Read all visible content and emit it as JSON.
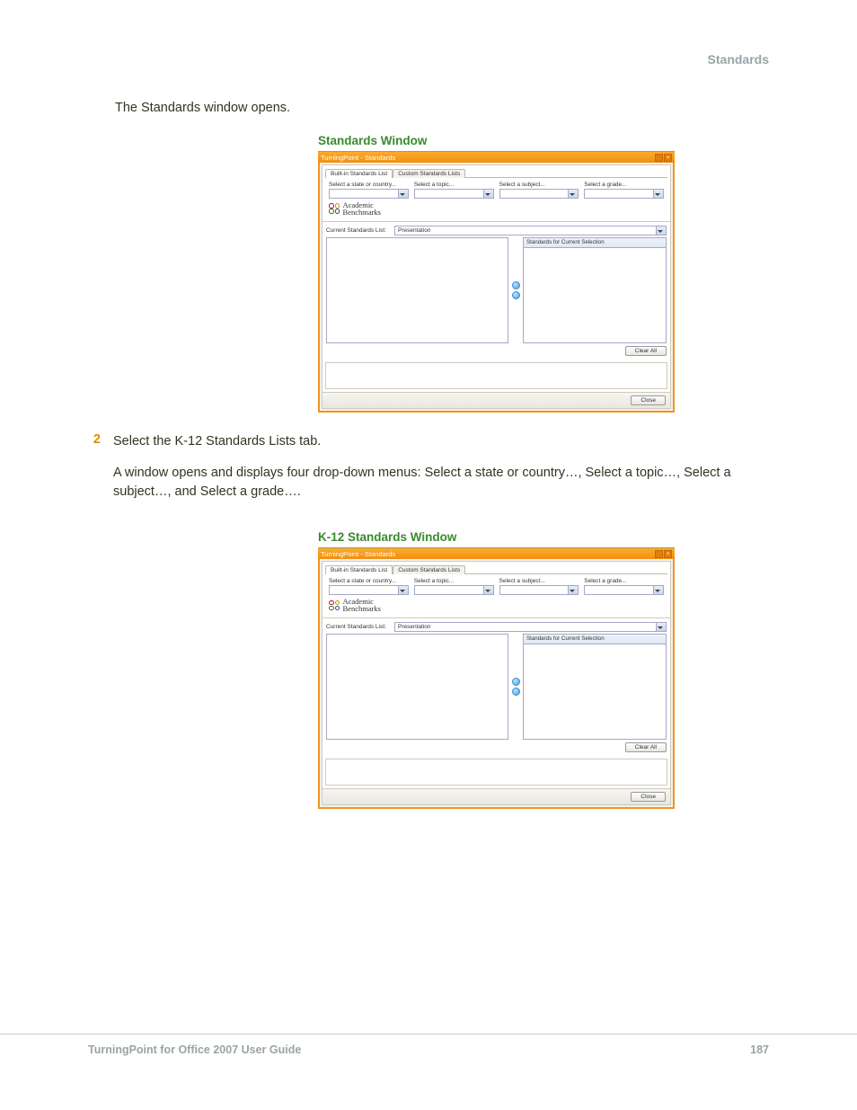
{
  "header": {
    "section": "Standards"
  },
  "intro": "The Standards window opens.",
  "figure1": {
    "caption": "Standards Window",
    "title": "TurningPoint - Standards",
    "tabs": {
      "builtin": "Built-in Standards List",
      "custom": "Custom Standards Lists"
    },
    "dropdowns": {
      "state": "Select a state or country...",
      "topic": "Select a topic...",
      "subject": "Select a subject...",
      "grade": "Select a grade..."
    },
    "logo": {
      "line1": "Academic",
      "line2": "Benchmarks"
    },
    "lists_label": "Current Standards List:",
    "lists_value": "Presentation",
    "right_title": "Standards for Current Selection",
    "clear_all": "Clear All",
    "close": "Close"
  },
  "step2": {
    "num": "2",
    "text": "Select the K-12 Standards Lists tab.",
    "para": "A window opens and displays four drop-down menus: Select a state or country…, Select a topic…, Select a subject…, and Select a grade…."
  },
  "figure2": {
    "caption": "K-12 Standards Window",
    "title": "TurningPoint - Standards",
    "tabs": {
      "builtin": "Built-in Standards List",
      "custom": "Custom Standards Lists"
    },
    "dropdowns": {
      "state": "Select a state or country...",
      "topic": "Select a topic...",
      "subject": "Select a subject...",
      "grade": "Select a grade..."
    },
    "logo": {
      "line1": "Academic",
      "line2": "Benchmarks"
    },
    "lists_label": "Current Standards List:",
    "lists_value": "Presentation",
    "right_title": "Standards for Current Selection",
    "clear_all": "Clear All",
    "close": "Close"
  },
  "footer": {
    "guide": "TurningPoint for Office 2007 User Guide",
    "page": "187"
  }
}
